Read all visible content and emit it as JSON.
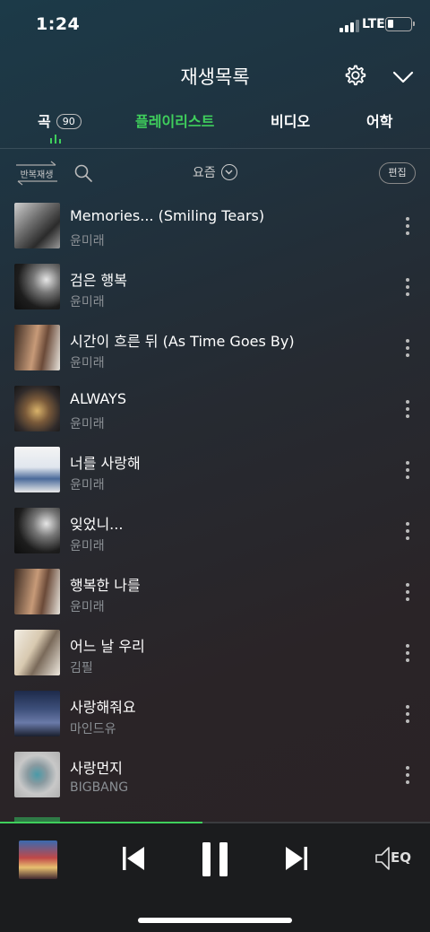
{
  "status_bar": {
    "time": "1:24",
    "network": "LTE"
  },
  "header": {
    "title": "재생목록",
    "settings_icon": "gear-icon",
    "collapse_icon": "chevron-down-icon"
  },
  "tabs": [
    {
      "label": "곡",
      "count": "90",
      "active": true
    },
    {
      "label": "플레이리스트",
      "highlighted": true
    },
    {
      "label": "비디오"
    },
    {
      "label": "어학"
    }
  ],
  "toolbar": {
    "repeat_label": "반복재생",
    "sort_label": "요즘",
    "edit_label": "편집"
  },
  "songs": [
    {
      "title": "Memories... (Smiling Tears)",
      "artist": "윤미래"
    },
    {
      "title": "검은 행복",
      "artist": "윤미래"
    },
    {
      "title": "시간이 흐른 뒤 (As Time Goes By)",
      "artist": "윤미래"
    },
    {
      "title": "ALWAYS",
      "artist": "윤미래"
    },
    {
      "title": "너를 사랑해",
      "artist": "윤미래"
    },
    {
      "title": "잊었니...",
      "artist": "윤미래"
    },
    {
      "title": "행복한 나를",
      "artist": "윤미래"
    },
    {
      "title": "어느 날 우리",
      "artist": "김필"
    },
    {
      "title": "사랑해줘요",
      "artist": "마인드유"
    },
    {
      "title": "사랑먼지",
      "artist": "BIGBANG"
    }
  ],
  "player": {
    "progress": 0.47,
    "eq_label": "EQ"
  },
  "colors": {
    "accent": "#3fcf5c",
    "artist_text": "#8a8f94",
    "player_bg": "#1b1c1e"
  }
}
